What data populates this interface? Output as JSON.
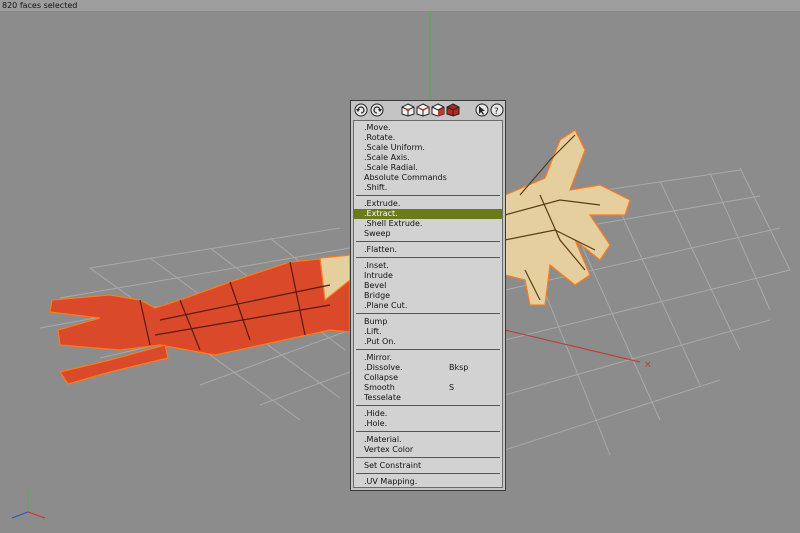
{
  "status": {
    "selection_text": "820 faces selected"
  },
  "toolbar": {
    "buttons": [
      {
        "name": "undo-icon"
      },
      {
        "name": "redo-icon"
      },
      {
        "name": "vertex-mode-cube-icon"
      },
      {
        "name": "edge-mode-cube-icon"
      },
      {
        "name": "face-mode-cube-icon"
      },
      {
        "name": "body-mode-cube-icon"
      },
      {
        "name": "pointer-icon"
      },
      {
        "name": "help-icon"
      }
    ]
  },
  "menu": {
    "items": [
      {
        "label": ".Move."
      },
      {
        "label": ".Rotate."
      },
      {
        "label": ".Scale Uniform."
      },
      {
        "label": ".Scale Axis."
      },
      {
        "label": ".Scale Radial."
      },
      {
        "label": "Absolute Commands"
      },
      {
        "label": ".Shift."
      },
      {
        "label": ".Extrude."
      },
      {
        "label": ".Extract.",
        "highlighted": true
      },
      {
        "label": ".Shell Extrude."
      },
      {
        "label": "Sweep"
      },
      {
        "label": ".Flatten."
      },
      {
        "label": ".Inset."
      },
      {
        "label": "Intrude"
      },
      {
        "label": "Bevel"
      },
      {
        "label": "Bridge"
      },
      {
        "label": ".Plane Cut."
      },
      {
        "label": "Bump"
      },
      {
        "label": ".Lift."
      },
      {
        "label": ".Put On."
      },
      {
        "label": ".Mirror."
      },
      {
        "label": ".Dissolve.",
        "shortcut": "Bksp"
      },
      {
        "label": "Collapse"
      },
      {
        "label": "Smooth",
        "shortcut": "S"
      },
      {
        "label": "Tesselate"
      },
      {
        "label": ".Hide."
      },
      {
        "label": ".Hole."
      },
      {
        "label": ".Material."
      },
      {
        "label": "Vertex Color"
      },
      {
        "label": "Set Constraint"
      },
      {
        "label": ".UV Mapping."
      }
    ],
    "groups": [
      7,
      4,
      1,
      5,
      3,
      5,
      2,
      2,
      1,
      1
    ],
    "highlight_color": "#6b7a1a"
  },
  "colors": {
    "background": "#8c8c8c",
    "selected_faces": "#d9492a",
    "model_faces": "#e6cf9e",
    "edge_highlight": "#ff7a1a",
    "grid": "#a8a8a8"
  }
}
